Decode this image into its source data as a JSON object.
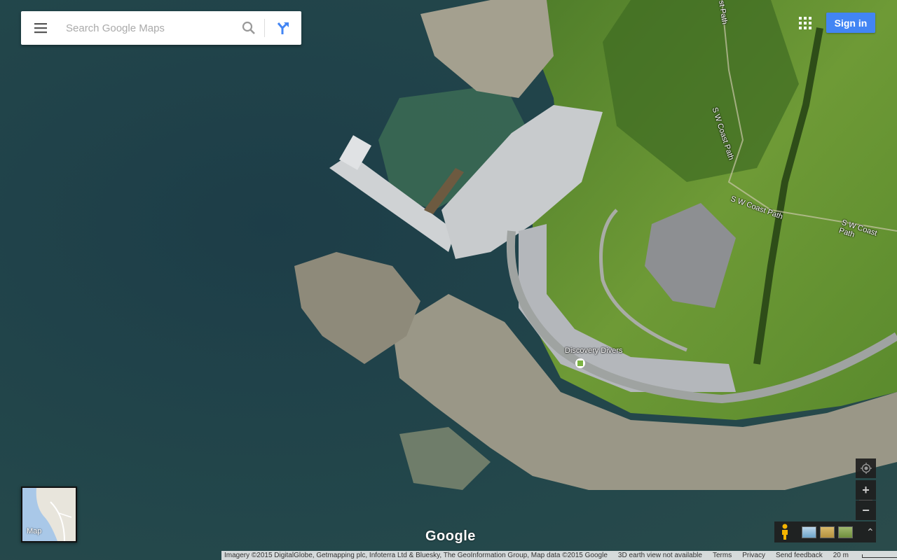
{
  "search": {
    "placeholder": "Search Google Maps"
  },
  "header": {
    "sign_in": "Sign in"
  },
  "map": {
    "labels": {
      "path_a": "S W Coast Path",
      "path_b": "S W Coast Path",
      "path_c": "S W Coast Path",
      "path_d": "st Path",
      "poi": "Discovery Divers"
    },
    "poi_color": "#7cb342"
  },
  "map_switcher": {
    "label": "Map"
  },
  "branding": {
    "logo": "Google"
  },
  "controls": {
    "zoom_in": "+",
    "zoom_out": "−",
    "expand": "⌃"
  },
  "footer": {
    "imagery": "Imagery ©2015 DigitalGlobe, Getmapping plc, Infoterra Ltd & Bluesky, The GeoInformation Group, Map data ©2015 Google",
    "earth": "3D earth view not available",
    "terms": "Terms",
    "privacy": "Privacy",
    "feedback": "Send feedback",
    "scale": "20 m"
  },
  "colors": {
    "accent": "#4285f4",
    "sea": "#1f3f45",
    "land": "#5f8e2f"
  }
}
